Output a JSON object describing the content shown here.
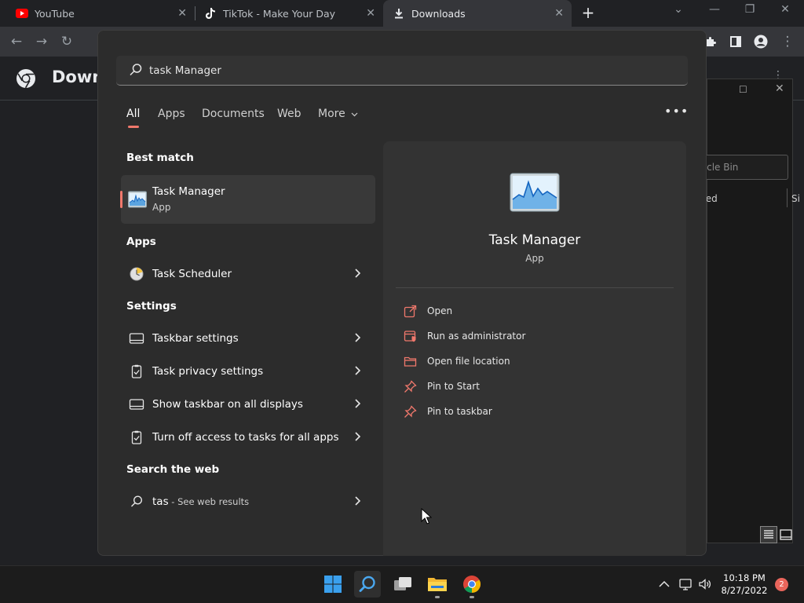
{
  "browser": {
    "tabs": [
      {
        "title": "YouTube",
        "icon": "youtube-icon"
      },
      {
        "title": "TikTok - Make Your Day",
        "icon": "tiktok-icon"
      },
      {
        "title": "Downloads",
        "icon": "download-icon",
        "active": true
      }
    ],
    "page_title": "Down"
  },
  "background_window": {
    "search_placeholder": "ycle Bin",
    "col1": "ted",
    "col2": "Si"
  },
  "search": {
    "query": "task Manager",
    "tabs": [
      "All",
      "Apps",
      "Documents",
      "Web",
      "More"
    ],
    "active_tab": "All",
    "best_match_heading": "Best match",
    "best_match": {
      "name": "Task Manager",
      "type": "App"
    },
    "apps_heading": "Apps",
    "apps": [
      {
        "label": "Task Scheduler"
      }
    ],
    "settings_heading": "Settings",
    "settings": [
      {
        "label": "Taskbar settings"
      },
      {
        "label": "Task privacy settings"
      },
      {
        "label": "Show taskbar on all displays"
      },
      {
        "label": "Turn off access to tasks for all apps"
      }
    ],
    "web_heading": "Search the web",
    "web": {
      "query": "tas",
      "suffix": " - See web results"
    }
  },
  "detail": {
    "name": "Task Manager",
    "type": "App",
    "actions": [
      "Open",
      "Run as administrator",
      "Open file location",
      "Pin to Start",
      "Pin to taskbar"
    ]
  },
  "taskbar": {
    "time": "10:18 PM",
    "date": "8/27/2022",
    "notifications": "2"
  },
  "colors": {
    "accent": "#f0786c",
    "flyout_bg": "#2c2c2c",
    "taskbar_bg": "#1c1c1c"
  }
}
